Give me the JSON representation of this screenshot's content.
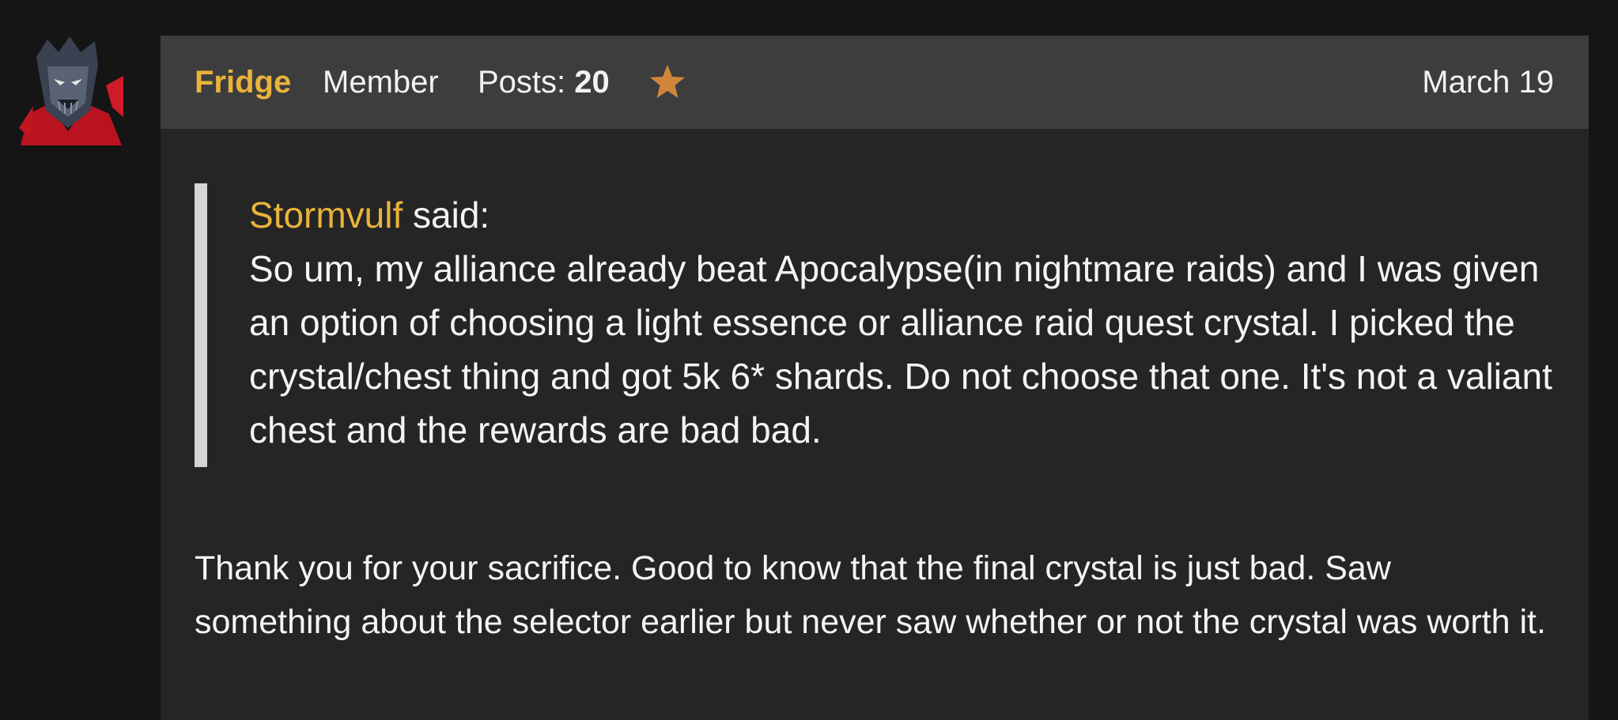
{
  "post": {
    "author": "Fridge",
    "role": "Member",
    "posts_label": "Posts:",
    "posts_count": "20",
    "badge_icon": "star-icon",
    "badge_color": "#d0863a",
    "date": "March 19",
    "avatar_icon": "avatar-icon",
    "quote": {
      "author": "Stormvulf",
      "said_label": "said:",
      "text": "So um, my alliance already beat Apocalypse(in nightmare raids) and I was given an option of choosing a light essence or alliance raid quest crystal. I picked the crystal/chest thing and got 5k 6* shards. Do not choose that one. It's not a valiant chest and the rewards are bad bad."
    },
    "body": "Thank you for your sacrifice. Good to know that the final crystal is just bad. Saw something about the selector earlier but never saw whether or not the crystal was worth it."
  },
  "colors": {
    "page_background": "#151515",
    "post_background": "#252525",
    "header_background": "#3d3d3d",
    "accent": "#e9b33b",
    "quote_bar": "#d5d5d5"
  }
}
